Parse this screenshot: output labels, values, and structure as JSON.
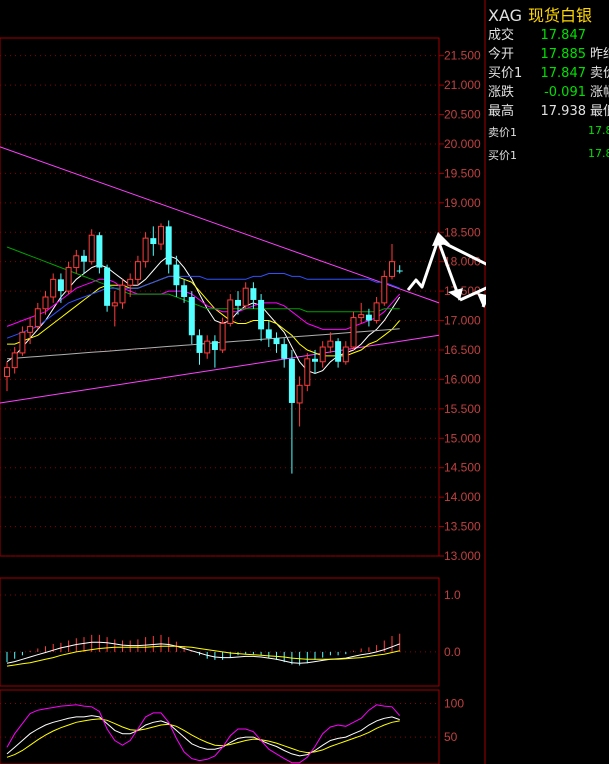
{
  "quote": {
    "symbol": "XAG",
    "name": "现货白银",
    "rows": [
      {
        "label": "成交",
        "value": "17.847",
        "label2": ""
      },
      {
        "label": "今开",
        "value": "17.885",
        "label2": "昨结"
      },
      {
        "label": "买价1",
        "value": "17.847",
        "label2": "卖价"
      },
      {
        "label": "涨跌",
        "value": "-0.091",
        "label2": "涨幅"
      },
      {
        "label": "最高",
        "value": "17.938",
        "label2": "最低"
      }
    ],
    "ask_label": "卖价1",
    "ask_value": "17.8",
    "bid_label": "买价1",
    "bid_value": "17.8"
  },
  "chart_data": [
    {
      "type": "candlestick",
      "panel": "price",
      "ylim": [
        13.0,
        21.8
      ],
      "y_ticks": [
        "21.500",
        "21.000",
        "20.500",
        "20.000",
        "19.500",
        "19.000",
        "18.500",
        "18.000",
        "17.500",
        "17.000",
        "16.500",
        "16.000",
        "15.500",
        "15.000",
        "14.500",
        "14.000",
        "13.500",
        "13.000"
      ],
      "candles": [
        [
          16.05,
          16.2,
          15.8,
          16.3
        ],
        [
          16.2,
          16.45,
          16.1,
          16.55
        ],
        [
          16.45,
          16.8,
          16.4,
          16.9
        ],
        [
          16.8,
          16.9,
          16.6,
          17.05
        ],
        [
          16.9,
          17.2,
          16.85,
          17.3
        ],
        [
          17.2,
          17.4,
          17.1,
          17.5
        ],
        [
          17.4,
          17.7,
          17.3,
          17.8
        ],
        [
          17.7,
          17.5,
          17.3,
          17.8
        ],
        [
          17.5,
          17.9,
          17.45,
          18.0
        ],
        [
          17.9,
          18.1,
          17.8,
          18.2
        ],
        [
          18.1,
          18.0,
          17.8,
          18.2
        ],
        [
          18.0,
          18.45,
          17.95,
          18.55
        ],
        [
          18.45,
          17.9,
          17.8,
          18.5
        ],
        [
          17.9,
          17.25,
          17.15,
          17.95
        ],
        [
          17.25,
          17.3,
          16.9,
          17.5
        ],
        [
          17.3,
          17.6,
          17.2,
          17.7
        ],
        [
          17.6,
          17.7,
          17.4,
          17.8
        ],
        [
          17.7,
          18.0,
          17.6,
          18.1
        ],
        [
          18.0,
          18.4,
          17.9,
          18.5
        ],
        [
          18.4,
          18.3,
          18.1,
          18.6
        ],
        [
          18.3,
          18.6,
          18.2,
          18.65
        ],
        [
          18.6,
          17.95,
          17.8,
          18.7
        ],
        [
          17.95,
          17.6,
          17.4,
          18.1
        ],
        [
          17.6,
          17.4,
          17.3,
          17.7
        ],
        [
          17.4,
          16.75,
          16.6,
          17.5
        ],
        [
          16.75,
          16.45,
          16.25,
          16.85
        ],
        [
          16.45,
          16.65,
          16.35,
          16.75
        ],
        [
          16.65,
          16.5,
          16.2,
          16.75
        ],
        [
          16.5,
          16.95,
          16.45,
          17.05
        ],
        [
          16.95,
          17.35,
          16.9,
          17.45
        ],
        [
          17.35,
          17.25,
          17.1,
          17.5
        ],
        [
          17.25,
          17.55,
          17.2,
          17.65
        ],
        [
          17.55,
          17.35,
          17.2,
          17.65
        ],
        [
          17.35,
          16.85,
          16.65,
          17.45
        ],
        [
          16.85,
          16.7,
          16.55,
          17.0
        ],
        [
          16.7,
          16.6,
          16.45,
          16.8
        ],
        [
          16.6,
          16.35,
          16.2,
          16.7
        ],
        [
          16.35,
          15.6,
          14.4,
          16.5
        ],
        [
          15.6,
          15.9,
          15.2,
          16.05
        ],
        [
          15.9,
          16.35,
          15.8,
          16.45
        ],
        [
          16.35,
          16.3,
          16.1,
          16.5
        ],
        [
          16.3,
          16.55,
          16.2,
          16.65
        ],
        [
          16.55,
          16.65,
          16.45,
          16.8
        ],
        [
          16.65,
          16.3,
          16.2,
          16.7
        ],
        [
          16.3,
          16.55,
          16.25,
          16.65
        ],
        [
          16.55,
          17.05,
          16.5,
          17.15
        ],
        [
          17.05,
          17.1,
          16.95,
          17.3
        ],
        [
          17.1,
          17.0,
          16.9,
          17.2
        ],
        [
          17.0,
          17.3,
          16.95,
          17.4
        ],
        [
          17.3,
          17.75,
          17.25,
          17.85
        ],
        [
          17.75,
          18.0,
          17.7,
          18.3
        ],
        [
          17.85,
          17.84,
          17.8,
          17.94
        ]
      ],
      "ma_lines": [
        {
          "color": "#ffffff",
          "values": [
            16.3,
            16.4,
            16.55,
            16.7,
            16.85,
            17.0,
            17.2,
            17.4,
            17.55,
            17.7,
            17.8,
            17.9,
            17.95,
            17.9,
            17.8,
            17.7,
            17.6,
            17.6,
            17.7,
            17.85,
            18.0,
            18.1,
            18.05,
            17.9,
            17.7,
            17.45,
            17.2,
            17.0,
            16.95,
            17.0,
            17.15,
            17.25,
            17.3,
            17.25,
            17.1,
            16.95,
            16.8,
            16.55,
            16.3,
            16.15,
            16.1,
            16.15,
            16.3,
            16.4,
            16.45,
            16.5,
            16.6,
            16.75,
            16.85,
            17.0,
            17.2,
            17.4
          ]
        },
        {
          "color": "#ffff00",
          "values": [
            16.6,
            16.6,
            16.65,
            16.7,
            16.75,
            16.85,
            16.95,
            17.05,
            17.15,
            17.25,
            17.35,
            17.45,
            17.55,
            17.6,
            17.6,
            17.6,
            17.55,
            17.55,
            17.6,
            17.65,
            17.7,
            17.75,
            17.75,
            17.7,
            17.65,
            17.5,
            17.35,
            17.2,
            17.1,
            17.0,
            16.95,
            16.95,
            17.0,
            17.0,
            17.0,
            16.95,
            16.85,
            16.75,
            16.6,
            16.5,
            16.45,
            16.4,
            16.4,
            16.4,
            16.4,
            16.45,
            16.5,
            16.6,
            16.65,
            16.75,
            16.85,
            17.0
          ]
        },
        {
          "color": "#ff00ff",
          "values": [
            16.9,
            16.95,
            17.0,
            17.05,
            17.1,
            17.15,
            17.25,
            17.35,
            17.45,
            17.55,
            17.6,
            17.65,
            17.7,
            17.7,
            17.65,
            17.55,
            17.5,
            17.45,
            17.45,
            17.45,
            17.45,
            17.5,
            17.5,
            17.5,
            17.45,
            17.35,
            17.25,
            17.2,
            17.15,
            17.15,
            17.15,
            17.2,
            17.25,
            17.3,
            17.3,
            17.3,
            17.25,
            17.15,
            17.05,
            16.95,
            16.9,
            16.85,
            16.85,
            16.85,
            16.85,
            16.9,
            16.95,
            17.0,
            17.05,
            17.15,
            17.3,
            17.45
          ]
        },
        {
          "color": "#00a000",
          "values": [
            18.25,
            18.2,
            18.15,
            18.1,
            18.05,
            18.0,
            17.95,
            17.9,
            17.85,
            17.8,
            17.75,
            17.7,
            17.65,
            17.6,
            17.55,
            17.5,
            17.45,
            17.45,
            17.45,
            17.45,
            17.45,
            17.45,
            17.4,
            17.35,
            17.3,
            17.25,
            17.2,
            17.2,
            17.2,
            17.2,
            17.2,
            17.2,
            17.2,
            17.2,
            17.2,
            17.2,
            17.2,
            17.2,
            17.2,
            17.15,
            17.15,
            17.15,
            17.15,
            17.15,
            17.15,
            17.15,
            17.15,
            17.15,
            17.15,
            17.2,
            17.2,
            17.2
          ]
        },
        {
          "color": "#3050ff",
          "values": [
            16.7,
            16.75,
            16.8,
            16.85,
            16.9,
            17.0,
            17.1,
            17.2,
            17.3,
            17.35,
            17.4,
            17.45,
            17.5,
            17.55,
            17.55,
            17.55,
            17.55,
            17.55,
            17.6,
            17.65,
            17.7,
            17.75,
            17.75,
            17.75,
            17.75,
            17.75,
            17.7,
            17.7,
            17.7,
            17.7,
            17.7,
            17.7,
            17.75,
            17.75,
            17.8,
            17.8,
            17.8,
            17.75,
            17.75,
            17.7,
            17.7,
            17.7,
            17.7,
            17.7,
            17.7,
            17.7,
            17.7,
            17.7,
            17.65,
            17.65,
            17.6,
            17.55
          ]
        },
        {
          "color": "#b0b0b0",
          "values": [
            16.35,
            16.36,
            16.37,
            16.38,
            16.39,
            16.4,
            16.41,
            16.42,
            16.43,
            16.44,
            16.45,
            16.46,
            16.47,
            16.48,
            16.49,
            16.5,
            16.51,
            16.52,
            16.53,
            16.54,
            16.55,
            16.56,
            16.57,
            16.58,
            16.59,
            16.6,
            16.61,
            16.62,
            16.63,
            16.64,
            16.65,
            16.66,
            16.67,
            16.68,
            16.69,
            16.7,
            16.71,
            16.72,
            16.73,
            16.74,
            16.75,
            16.76,
            16.77,
            16.78,
            16.79,
            16.8,
            16.81,
            16.82,
            16.83,
            16.84,
            16.85,
            16.86
          ]
        }
      ]
    },
    {
      "type": "bar",
      "panel": "macd",
      "ylim": [
        -0.6,
        1.3
      ],
      "y_ticks": [
        "1.0",
        "0.0"
      ],
      "values": [
        -0.18,
        -0.12,
        -0.06,
        0.02,
        0.06,
        0.1,
        0.14,
        0.16,
        0.2,
        0.24,
        0.26,
        0.3,
        0.3,
        0.26,
        0.22,
        0.2,
        0.2,
        0.22,
        0.26,
        0.28,
        0.3,
        0.26,
        0.18,
        0.1,
        0.02,
        -0.06,
        -0.12,
        -0.14,
        -0.14,
        -0.1,
        -0.06,
        -0.04,
        -0.04,
        -0.06,
        -0.1,
        -0.14,
        -0.18,
        -0.22,
        -0.24,
        -0.2,
        -0.14,
        -0.1,
        -0.06,
        -0.06,
        -0.04,
        0.02,
        0.06,
        0.08,
        0.12,
        0.2,
        0.28,
        0.32
      ],
      "lines": [
        {
          "color": "#ffffff",
          "values": [
            -0.2,
            -0.17,
            -0.13,
            -0.09,
            -0.05,
            -0.01,
            0.03,
            0.07,
            0.1,
            0.13,
            0.15,
            0.17,
            0.17,
            0.16,
            0.14,
            0.12,
            0.11,
            0.11,
            0.12,
            0.13,
            0.14,
            0.13,
            0.1,
            0.06,
            0.02,
            -0.02,
            -0.06,
            -0.09,
            -0.1,
            -0.1,
            -0.09,
            -0.08,
            -0.08,
            -0.09,
            -0.11,
            -0.13,
            -0.16,
            -0.19,
            -0.2,
            -0.19,
            -0.17,
            -0.15,
            -0.13,
            -0.12,
            -0.11,
            -0.08,
            -0.05,
            -0.03,
            0.0,
            0.04,
            0.09,
            0.14
          ]
        },
        {
          "color": "#ffff00",
          "values": [
            -0.25,
            -0.23,
            -0.21,
            -0.19,
            -0.16,
            -0.13,
            -0.1,
            -0.06,
            -0.03,
            0.0,
            0.02,
            0.04,
            0.06,
            0.07,
            0.08,
            0.08,
            0.08,
            0.08,
            0.08,
            0.09,
            0.1,
            0.1,
            0.1,
            0.09,
            0.08,
            0.06,
            0.04,
            0.02,
            0.0,
            -0.02,
            -0.03,
            -0.04,
            -0.05,
            -0.06,
            -0.07,
            -0.08,
            -0.09,
            -0.11,
            -0.12,
            -0.13,
            -0.13,
            -0.13,
            -0.13,
            -0.13,
            -0.12,
            -0.11,
            -0.1,
            -0.08,
            -0.06,
            -0.04,
            -0.01,
            0.02
          ]
        }
      ]
    },
    {
      "type": "line",
      "panel": "kdj",
      "ylim": [
        10,
        120
      ],
      "y_ticks": [
        "100",
        "50"
      ],
      "lines": [
        {
          "color": "#ffffff",
          "values": [
            25,
            35,
            45,
            55,
            62,
            68,
            72,
            75,
            78,
            80,
            80,
            82,
            80,
            70,
            60,
            55,
            55,
            60,
            68,
            72,
            74,
            70,
            60,
            50,
            40,
            35,
            32,
            32,
            35,
            42,
            48,
            50,
            50,
            45,
            40,
            36,
            30,
            25,
            22,
            24,
            30,
            38,
            45,
            48,
            50,
            55,
            60,
            68,
            74,
            78,
            80,
            76
          ]
        },
        {
          "color": "#ffff00",
          "values": [
            20,
            24,
            30,
            38,
            46,
            53,
            59,
            64,
            68,
            72,
            74,
            76,
            77,
            75,
            70,
            65,
            61,
            60,
            62,
            65,
            68,
            69,
            66,
            60,
            53,
            47,
            42,
            38,
            37,
            39,
            42,
            45,
            47,
            46,
            44,
            41,
            37,
            33,
            29,
            27,
            28,
            31,
            36,
            40,
            44,
            48,
            52,
            57,
            63,
            68,
            72,
            74
          ]
        },
        {
          "color": "#ff00ff",
          "values": [
            35,
            55,
            70,
            85,
            90,
            92,
            94,
            96,
            97,
            98,
            96,
            95,
            88,
            62,
            45,
            38,
            45,
            62,
            80,
            86,
            86,
            72,
            48,
            28,
            18,
            15,
            17,
            22,
            35,
            52,
            62,
            62,
            58,
            45,
            32,
            25,
            18,
            12,
            12,
            20,
            36,
            55,
            65,
            68,
            66,
            72,
            78,
            90,
            98,
            96,
            95,
            82
          ]
        }
      ]
    }
  ]
}
